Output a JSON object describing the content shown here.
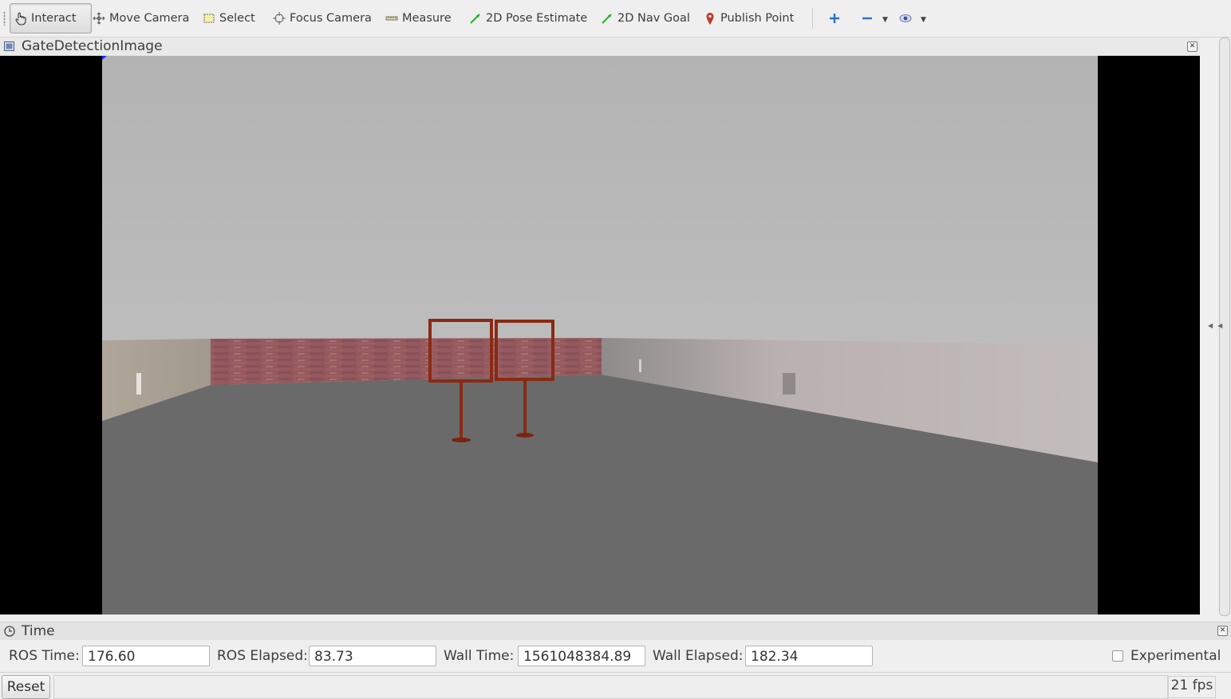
{
  "toolbar": {
    "tools": [
      {
        "label": "Interact",
        "icon": "hand-pointer-icon",
        "active": true
      },
      {
        "label": "Move Camera",
        "icon": "move-arrows-icon"
      },
      {
        "label": "Select",
        "icon": "select-box-icon"
      },
      {
        "label": "Focus Camera",
        "icon": "crosshair-icon"
      },
      {
        "label": "Measure",
        "icon": "ruler-icon"
      },
      {
        "label": "2D Pose Estimate",
        "icon": "green-arrow-icon"
      },
      {
        "label": "2D Nav Goal",
        "icon": "green-arrow-icon"
      },
      {
        "label": "Publish Point",
        "icon": "map-pin-icon"
      }
    ],
    "extra_icons": [
      "plus-icon",
      "minus-icon",
      "eye-icon"
    ]
  },
  "image_panel": {
    "title": "GateDetectionImage"
  },
  "time_panel": {
    "title": "Time",
    "ros_time_label": "ROS Time:",
    "ros_time_value": "176.60",
    "ros_elapsed_label": "ROS Elapsed:",
    "ros_elapsed_value": "83.73",
    "wall_time_label": "Wall Time:",
    "wall_time_value": "1561048384.89",
    "wall_elapsed_label": "Wall Elapsed:",
    "wall_elapsed_value": "182.34",
    "experimental_label": "Experimental",
    "experimental_checked": false
  },
  "status": {
    "reset_label": "Reset",
    "fps": "21 fps"
  },
  "colors": {
    "gate": "#8a2a14",
    "floor": "#696969",
    "sky": "#b6b6b6"
  }
}
